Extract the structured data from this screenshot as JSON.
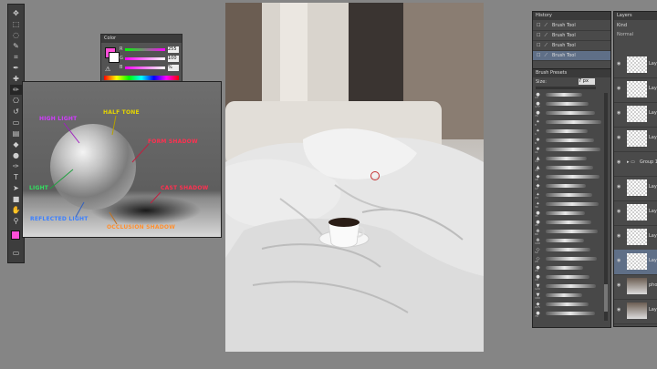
{
  "tools": [
    {
      "icon": "move-icon",
      "glyph": "✥"
    },
    {
      "icon": "marquee-icon",
      "glyph": "⬚"
    },
    {
      "icon": "lasso-icon",
      "glyph": "◌"
    },
    {
      "icon": "quick-select-icon",
      "glyph": "✎"
    },
    {
      "icon": "crop-icon",
      "glyph": "⌗"
    },
    {
      "icon": "eyedropper-icon",
      "glyph": "✒"
    },
    {
      "icon": "healing-icon",
      "glyph": "✚"
    },
    {
      "icon": "brush-icon",
      "glyph": "✏"
    },
    {
      "icon": "stamp-icon",
      "glyph": "⎔"
    },
    {
      "icon": "history-brush-icon",
      "glyph": "↺"
    },
    {
      "icon": "eraser-icon",
      "glyph": "▭"
    },
    {
      "icon": "gradient-icon",
      "glyph": "▤"
    },
    {
      "icon": "blur-icon",
      "glyph": "◆"
    },
    {
      "icon": "dodge-icon",
      "glyph": "●"
    },
    {
      "icon": "pen-icon",
      "glyph": "✑"
    },
    {
      "icon": "type-icon",
      "glyph": "T"
    },
    {
      "icon": "path-select-icon",
      "glyph": "➤"
    },
    {
      "icon": "shape-icon",
      "glyph": "■"
    },
    {
      "icon": "hand-icon",
      "glyph": "✋"
    },
    {
      "icon": "zoom-icon",
      "glyph": "⚲"
    },
    {
      "icon": "more-icon",
      "glyph": "…"
    }
  ],
  "colors": {
    "foreground": "#ff4fd8",
    "background": "#ffffff",
    "accent": "#5f6f87"
  },
  "color_panel": {
    "title": "Color",
    "channels": [
      {
        "label": "R",
        "value": "255"
      },
      {
        "label": "G",
        "value": "100"
      },
      {
        "label": "B",
        "value": "%"
      }
    ]
  },
  "reference": {
    "labels": {
      "highlight": "HIGH LIGHT",
      "halftone": "HALF TONE",
      "form_shadow": "FORM SHADOW",
      "light": "LIGHT",
      "cast_shadow": "CAST SHADOW",
      "reflected_light": "REFLECTED LIGHT",
      "occlusion_shadow": "OCCLUSION SHADOW"
    }
  },
  "history": {
    "tabs": [
      "History"
    ],
    "items": [
      "Brush Tool",
      "Brush Tool",
      "Brush Tool",
      "Brush Tool"
    ]
  },
  "brush_presets": {
    "title": "Brush Presets",
    "size_label": "Size:",
    "size_value": "7 px",
    "sizes": [
      "13",
      "177",
      "70",
      "8",
      "1",
      "6",
      "11",
      "14",
      "15",
      "16",
      "17",
      "24",
      "30",
      "35",
      "45",
      "80",
      "109",
      "52",
      "25",
      "29",
      "13",
      "120",
      "160",
      "225",
      "79"
    ]
  },
  "layers": {
    "tab": "Layers",
    "kind": "Kind",
    "mode": "Normal",
    "items": [
      {
        "name": "Lay",
        "type": "checker"
      },
      {
        "name": "Lay",
        "type": "checker"
      },
      {
        "name": "Lay",
        "type": "checker"
      },
      {
        "name": "Lay",
        "type": "checker"
      },
      {
        "name": "Group 1",
        "type": "group"
      },
      {
        "name": "Lay",
        "type": "checker"
      },
      {
        "name": "Lay",
        "type": "checker"
      },
      {
        "name": "Lay",
        "type": "checker"
      },
      {
        "name": "Lay",
        "type": "selected"
      },
      {
        "name": "photo",
        "type": "photo"
      },
      {
        "name": "Lay",
        "type": "photo2"
      }
    ]
  }
}
